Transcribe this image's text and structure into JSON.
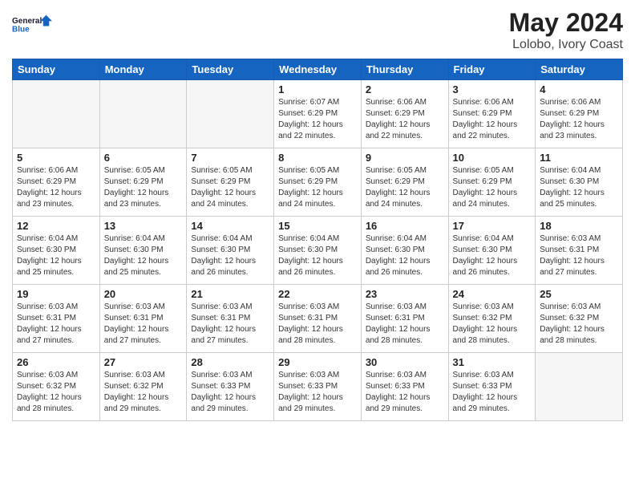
{
  "header": {
    "logo_line1": "General",
    "logo_line2": "Blue",
    "main_title": "May 2024",
    "subtitle": "Lolobo, Ivory Coast"
  },
  "days_of_week": [
    "Sunday",
    "Monday",
    "Tuesday",
    "Wednesday",
    "Thursday",
    "Friday",
    "Saturday"
  ],
  "weeks": [
    [
      {
        "day": "",
        "info": ""
      },
      {
        "day": "",
        "info": ""
      },
      {
        "day": "",
        "info": ""
      },
      {
        "day": "1",
        "info": "Sunrise: 6:07 AM\nSunset: 6:29 PM\nDaylight: 12 hours\nand 22 minutes."
      },
      {
        "day": "2",
        "info": "Sunrise: 6:06 AM\nSunset: 6:29 PM\nDaylight: 12 hours\nand 22 minutes."
      },
      {
        "day": "3",
        "info": "Sunrise: 6:06 AM\nSunset: 6:29 PM\nDaylight: 12 hours\nand 22 minutes."
      },
      {
        "day": "4",
        "info": "Sunrise: 6:06 AM\nSunset: 6:29 PM\nDaylight: 12 hours\nand 23 minutes."
      }
    ],
    [
      {
        "day": "5",
        "info": "Sunrise: 6:06 AM\nSunset: 6:29 PM\nDaylight: 12 hours\nand 23 minutes."
      },
      {
        "day": "6",
        "info": "Sunrise: 6:05 AM\nSunset: 6:29 PM\nDaylight: 12 hours\nand 23 minutes."
      },
      {
        "day": "7",
        "info": "Sunrise: 6:05 AM\nSunset: 6:29 PM\nDaylight: 12 hours\nand 24 minutes."
      },
      {
        "day": "8",
        "info": "Sunrise: 6:05 AM\nSunset: 6:29 PM\nDaylight: 12 hours\nand 24 minutes."
      },
      {
        "day": "9",
        "info": "Sunrise: 6:05 AM\nSunset: 6:29 PM\nDaylight: 12 hours\nand 24 minutes."
      },
      {
        "day": "10",
        "info": "Sunrise: 6:05 AM\nSunset: 6:29 PM\nDaylight: 12 hours\nand 24 minutes."
      },
      {
        "day": "11",
        "info": "Sunrise: 6:04 AM\nSunset: 6:30 PM\nDaylight: 12 hours\nand 25 minutes."
      }
    ],
    [
      {
        "day": "12",
        "info": "Sunrise: 6:04 AM\nSunset: 6:30 PM\nDaylight: 12 hours\nand 25 minutes."
      },
      {
        "day": "13",
        "info": "Sunrise: 6:04 AM\nSunset: 6:30 PM\nDaylight: 12 hours\nand 25 minutes."
      },
      {
        "day": "14",
        "info": "Sunrise: 6:04 AM\nSunset: 6:30 PM\nDaylight: 12 hours\nand 26 minutes."
      },
      {
        "day": "15",
        "info": "Sunrise: 6:04 AM\nSunset: 6:30 PM\nDaylight: 12 hours\nand 26 minutes."
      },
      {
        "day": "16",
        "info": "Sunrise: 6:04 AM\nSunset: 6:30 PM\nDaylight: 12 hours\nand 26 minutes."
      },
      {
        "day": "17",
        "info": "Sunrise: 6:04 AM\nSunset: 6:30 PM\nDaylight: 12 hours\nand 26 minutes."
      },
      {
        "day": "18",
        "info": "Sunrise: 6:03 AM\nSunset: 6:31 PM\nDaylight: 12 hours\nand 27 minutes."
      }
    ],
    [
      {
        "day": "19",
        "info": "Sunrise: 6:03 AM\nSunset: 6:31 PM\nDaylight: 12 hours\nand 27 minutes."
      },
      {
        "day": "20",
        "info": "Sunrise: 6:03 AM\nSunset: 6:31 PM\nDaylight: 12 hours\nand 27 minutes."
      },
      {
        "day": "21",
        "info": "Sunrise: 6:03 AM\nSunset: 6:31 PM\nDaylight: 12 hours\nand 27 minutes."
      },
      {
        "day": "22",
        "info": "Sunrise: 6:03 AM\nSunset: 6:31 PM\nDaylight: 12 hours\nand 28 minutes."
      },
      {
        "day": "23",
        "info": "Sunrise: 6:03 AM\nSunset: 6:31 PM\nDaylight: 12 hours\nand 28 minutes."
      },
      {
        "day": "24",
        "info": "Sunrise: 6:03 AM\nSunset: 6:32 PM\nDaylight: 12 hours\nand 28 minutes."
      },
      {
        "day": "25",
        "info": "Sunrise: 6:03 AM\nSunset: 6:32 PM\nDaylight: 12 hours\nand 28 minutes."
      }
    ],
    [
      {
        "day": "26",
        "info": "Sunrise: 6:03 AM\nSunset: 6:32 PM\nDaylight: 12 hours\nand 28 minutes."
      },
      {
        "day": "27",
        "info": "Sunrise: 6:03 AM\nSunset: 6:32 PM\nDaylight: 12 hours\nand 29 minutes."
      },
      {
        "day": "28",
        "info": "Sunrise: 6:03 AM\nSunset: 6:33 PM\nDaylight: 12 hours\nand 29 minutes."
      },
      {
        "day": "29",
        "info": "Sunrise: 6:03 AM\nSunset: 6:33 PM\nDaylight: 12 hours\nand 29 minutes."
      },
      {
        "day": "30",
        "info": "Sunrise: 6:03 AM\nSunset: 6:33 PM\nDaylight: 12 hours\nand 29 minutes."
      },
      {
        "day": "31",
        "info": "Sunrise: 6:03 AM\nSunset: 6:33 PM\nDaylight: 12 hours\nand 29 minutes."
      },
      {
        "day": "",
        "info": ""
      }
    ]
  ]
}
